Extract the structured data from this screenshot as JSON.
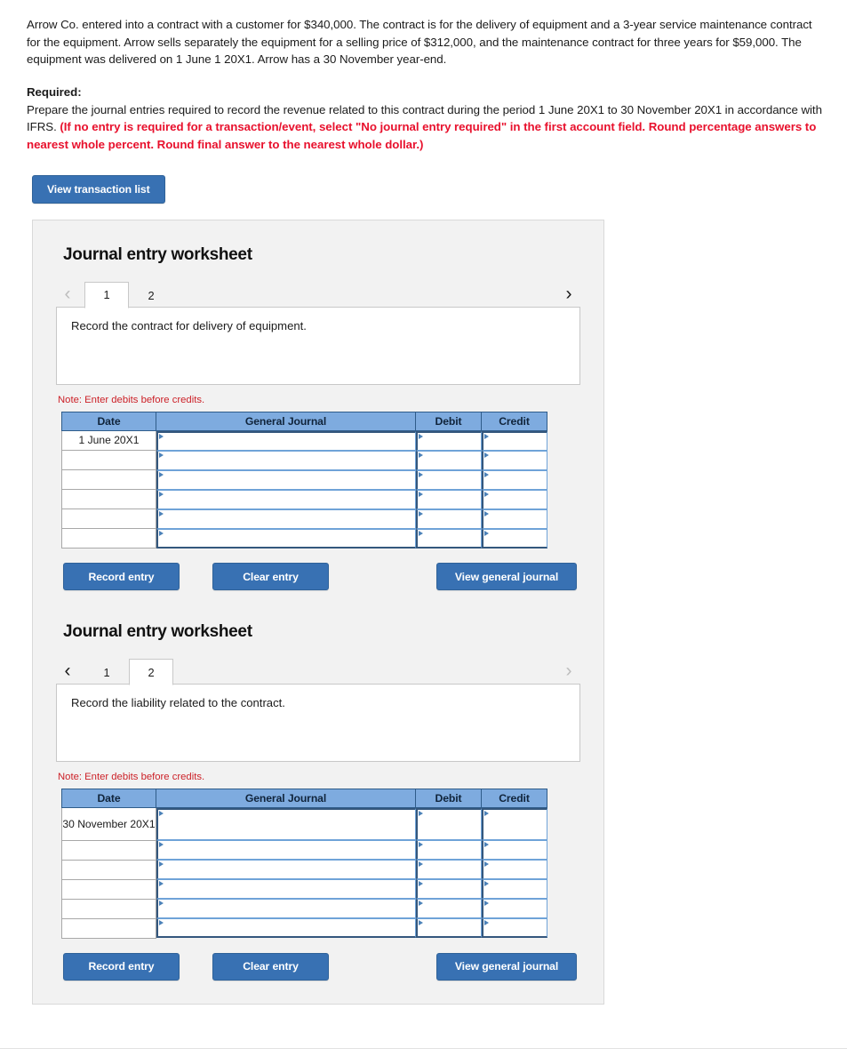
{
  "problem": {
    "statement": "Arrow Co. entered into a contract with a customer for $340,000. The contract is for the delivery of equipment and a 3-year service maintenance contract for the equipment. Arrow sells separately the equipment for a selling price of $312,000, and the maintenance contract for three years for $59,000. The equipment was delivered on 1 June 1 20X1. Arrow has a 30 November year-end.",
    "required_label": "Required:",
    "required_text_1": "Prepare the journal entries required to record the revenue related to this contract during the period 1 June 20X1 to 30 November 20X1 in accordance with IFRS. ",
    "required_text_red": "(If no entry is required for a transaction/event, select \"No journal entry required\" in the first account field. Round percentage answers to nearest whole percent. Round final answer to the nearest whole dollar.)"
  },
  "toolbar": {
    "view_transaction_list_label": "View transaction list"
  },
  "colors": {
    "button_blue": "#3871b3",
    "table_header_blue": "#7eabdf",
    "note_red": "#cc2128",
    "required_red": "#e8112d",
    "panel_gray": "#f2f2f2"
  },
  "table_columns": [
    "Date",
    "General Journal",
    "Debit",
    "Credit"
  ],
  "actions": {
    "record_entry": "Record entry",
    "clear_entry": "Clear entry",
    "view_general_journal": "View general journal"
  },
  "note_text": "Note: Enter debits before credits.",
  "icons": {
    "chevron_left": "‹",
    "chevron_right": "›"
  },
  "worksheets": [
    {
      "title": "Journal entry worksheet",
      "tabs": [
        {
          "label": "1",
          "active": true
        },
        {
          "label": "2",
          "active": false
        }
      ],
      "prev_enabled": false,
      "next_enabled": true,
      "description": "Record the contract for delivery of equipment.",
      "rows": [
        {
          "date": "1 June 20X1",
          "general_journal": "",
          "debit": "",
          "credit": "",
          "tall": false
        },
        {
          "date": "",
          "general_journal": "",
          "debit": "",
          "credit": "",
          "tall": false
        },
        {
          "date": "",
          "general_journal": "",
          "debit": "",
          "credit": "",
          "tall": false
        },
        {
          "date": "",
          "general_journal": "",
          "debit": "",
          "credit": "",
          "tall": false
        },
        {
          "date": "",
          "general_journal": "",
          "debit": "",
          "credit": "",
          "tall": false
        },
        {
          "date": "",
          "general_journal": "",
          "debit": "",
          "credit": "",
          "tall": false
        }
      ]
    },
    {
      "title": "Journal entry worksheet",
      "tabs": [
        {
          "label": "1",
          "active": false
        },
        {
          "label": "2",
          "active": true
        }
      ],
      "prev_enabled": true,
      "next_enabled": false,
      "description": "Record the liability related to the contract.",
      "rows": [
        {
          "date": "30 November 20X1",
          "general_journal": "",
          "debit": "",
          "credit": "",
          "tall": true
        },
        {
          "date": "",
          "general_journal": "",
          "debit": "",
          "credit": "",
          "tall": false
        },
        {
          "date": "",
          "general_journal": "",
          "debit": "",
          "credit": "",
          "tall": false
        },
        {
          "date": "",
          "general_journal": "",
          "debit": "",
          "credit": "",
          "tall": false
        },
        {
          "date": "",
          "general_journal": "",
          "debit": "",
          "credit": "",
          "tall": false
        },
        {
          "date": "",
          "general_journal": "",
          "debit": "",
          "credit": "",
          "tall": false
        }
      ]
    }
  ]
}
